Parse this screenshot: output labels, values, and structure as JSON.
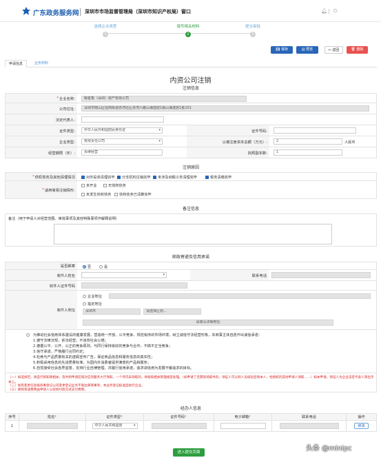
{
  "header": {
    "site": "广东政务服务网",
    "title": "深圳市市场监督管理局（深圳市知识产权局）窗口"
  },
  "steps": [
    {
      "label": "选择企业类型",
      "num": "1"
    },
    {
      "label": "填写相关材料",
      "num": "2"
    },
    {
      "label": "提交审批",
      "num": "3"
    }
  ],
  "toolbar": {
    "save": "保存",
    "preview": "预览",
    "back": "返回",
    "delete": "删除"
  },
  "tabs": [
    "申请信息",
    "业务材料"
  ],
  "form_title": "内资公司注销",
  "sec_reg": "注销信息",
  "reg": {
    "company_name_label": "企业名称:",
    "company_name": "郁金香（深圳）房产有限公司",
    "address_label": "公司住址:",
    "address": "深圳市南山区招商街道赤湾社区赤湾六路山海逸居1栋山海逸居1栋101",
    "legal_label": "法定代表人:",
    "legal": "",
    "idtype_label": "证件类型:",
    "idtype": "中华人民共和国居民身份证",
    "idno_label": "证件号码:",
    "idno": "",
    "ctype_label": "企业类型:",
    "ctype": "有限责任公司",
    "capital_label": "认缴注册资本总额（万元）:",
    "capital": "2",
    "capital_unit": "人民币",
    "term_label": "经营期限（年）:",
    "term": "永续经营",
    "copies_label": "执照副本数:",
    "copies": "1"
  },
  "sec_reason": "注销原因",
  "reason": {
    "debt_label": "债权债务及其他清理情况",
    "debt_opts": [
      "对外投资清理完毕",
      "分支机构注销完毕",
      "未涉及纳税义务清理完毕",
      "税务清缴完毕"
    ],
    "simple_label": "适用简易注销情形:",
    "simple_opts": [
      "未开业",
      "无债权债务",
      "未发生债权债务",
      "债权债务已清算完毕"
    ]
  },
  "sec_note": "备注信息",
  "note_label": "备注（用于申请人对经营范围、审批事项及其他特殊事项作解释说明）",
  "sec_post": "邮政寄递及信用承诺",
  "post": {
    "mail_label": "是否邮寄",
    "mail_no": "否",
    "mail_yes": "是",
    "recv_name_label": "收件人姓名",
    "recv_phone_label": "联系电话",
    "recv_id_label": "收件人证件号码",
    "recv_addr_label": "收件人地址",
    "addr_opt1": "企业地址",
    "addr_opt2": "指定地址",
    "city": "深圳市",
    "district": "请选择区划...",
    "detail": "请填写详细地址"
  },
  "promise": [
    "为推动社会信用体系建设的健康发展，营造统一开放、公平竞争、规范有序的市场环境，树立诚信守法经营形象，本商事主体自愿作出诚信承诺：",
    "1.遵守法律法规，依法经营，不违背社会公德；",
    "2.遵循公平、公开、公正的竞争原则，与同行保持良好的竞争与合作，不搞不正当竞争；",
    "3.信守承诺，严格履行合同约定；",
    "4.杜绝与产品质量有关的虚假宣传广告，保证商品信息和服务信息的真实性；",
    "5.积极采用信息的先进质量标准，为国内外消费者提供满意的产品和服务；",
    "6.自觉接受社会各界监督，支持行业自律管理，并履行信用承诺，追求讲信用为发展不懈追求的目标。"
  ],
  "red_notes": [
    "（一）如选择否，请自行到知晓相关，及时到申请区域对应的服务大厅领取，一个月内未领取的，将按照相关管理规定处理。（如申请了无需现场取件的，领证人可以到人员核验后到本人、经授权的其他申请人领取……）如本申请，领证人为企业法定代表人须出示本人。",
    "（二）如有变更信息按商事登记公司变更登记业务不受此邮寄事项，本业务登记核准后执行企业。",
    "（三）邮政寄递费用由申请人以货到付款方式支付费用。"
  ],
  "sec_agent": "经办人信息",
  "agent": {
    "cols": [
      "序号",
      "姓名",
      "证件类型",
      "证件号码",
      "电子邮箱",
      "联系电话",
      "操作"
    ],
    "row": {
      "no": "1",
      "idtype": "中华人民共和国居",
      "op": "修改"
    }
  },
  "submit": "进入提交页面",
  "watermark": "头条 @minipc",
  "colors": {
    "blue": "#2a66b8",
    "green": "#2d9e3e",
    "red": "#e9524f"
  }
}
